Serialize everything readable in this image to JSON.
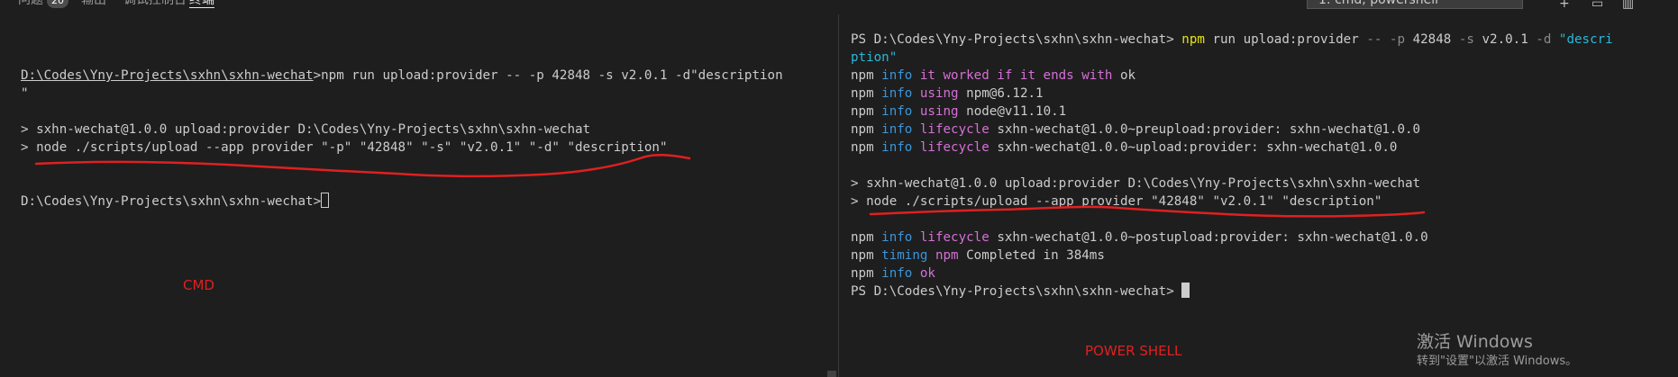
{
  "tabs": [
    {
      "label": "问题",
      "badge": "20"
    },
    {
      "label": "输出"
    },
    {
      "label": "调试控制台"
    },
    {
      "label": "终端",
      "active": true
    }
  ],
  "toolbar": {
    "terminal_select": "1: cmd, powershell",
    "icons": [
      "plus-icon",
      "split-icon",
      "trash-icon"
    ]
  },
  "cmd": {
    "prompt_path": "D:\\Codes\\Yny-Projects\\sxhn\\sxhn-wechat",
    "command": "npm run upload:provider -- -p 42848 -s v2.0.1 -d\"description",
    "command_wrap": "\"",
    "output1": "> sxhn-wechat@1.0.0 upload:provider D:\\Codes\\Yny-Projects\\sxhn\\sxhn-wechat",
    "output2": "> node ./scripts/upload --app provider \"-p\" \"42848\" \"-s\" \"v2.0.1\" \"-d\" \"description\"",
    "final_prompt": "D:\\Codes\\Yny-Projects\\sxhn\\sxhn-wechat>",
    "annotation": "CMD"
  },
  "ps": {
    "prompt": "PS D:\\Codes\\Yny-Projects\\sxhn\\sxhn-wechat>",
    "cmd_npm": "npm",
    "cmd_run": "run upload:provider",
    "cmd_flag1": "-- -p",
    "cmd_val1": "42848",
    "cmd_flag2": "-s",
    "cmd_val2": "v2.0.1",
    "cmd_flag3": "-d",
    "cmd_val3": "\"descri",
    "cmd_wrap": "ption\"",
    "info_lines": [
      {
        "tag": "info",
        "text": "it worked if it ends with",
        "tail": "ok"
      },
      {
        "tag": "info",
        "text": "using",
        "tail": "npm@6.12.1"
      },
      {
        "tag": "info",
        "text": "using",
        "tail": "node@v11.10.1"
      },
      {
        "tag": "info",
        "text": "lifecycle",
        "tail": "sxhn-wechat@1.0.0~preupload:provider: sxhn-wechat@1.0.0"
      },
      {
        "tag": "info",
        "text": "lifecycle",
        "tail": "sxhn-wechat@1.0.0~upload:provider: sxhn-wechat@1.0.0"
      }
    ],
    "output1": "> sxhn-wechat@1.0.0 upload:provider D:\\Codes\\Yny-Projects\\sxhn\\sxhn-wechat",
    "output2": "> node ./scripts/upload --app provider \"42848\" \"v2.0.1\" \"description\"",
    "post_lines": [
      {
        "tag": "info",
        "text": "lifecycle",
        "tail": "sxhn-wechat@1.0.0~postupload:provider: sxhn-wechat@1.0.0"
      },
      {
        "tag": "timing",
        "text": "npm",
        "tail": "Completed in 384ms"
      },
      {
        "tag": "info",
        "text": "ok",
        "tail": ""
      }
    ],
    "npm_word": "npm",
    "annotation": "POWER SHELL"
  },
  "activation": {
    "title": "激活 Windows",
    "subtitle": "转到\"设置\"以激活 Windows。"
  },
  "colors": {
    "background": "#1e1e1e",
    "info": "#3a96dd",
    "magenta": "#d670d6",
    "yellow": "#e5e510",
    "annotation_red": "#e02020"
  }
}
